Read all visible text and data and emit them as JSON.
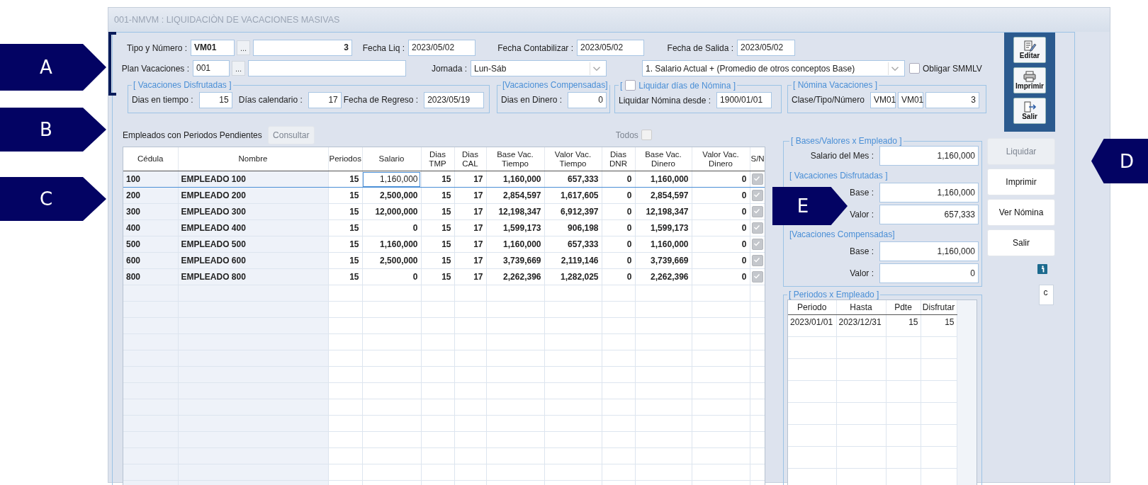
{
  "window": {
    "title": "001-NMVM : LIQUIDACIÒN DE VACACIONES MASIVAS"
  },
  "header": {
    "tipo_numero": {
      "label": "Tipo y Número :",
      "type": "VM01",
      "number": "3",
      "lookup": "..."
    },
    "fecha_liq": {
      "label": "Fecha Liq :",
      "value": "2023/05/02"
    },
    "fecha_contabilizar": {
      "label": "Fecha Contabilizar :",
      "value": "2023/05/02"
    },
    "fecha_salida": {
      "label": "Fecha de Salida :",
      "value": "2023/05/02"
    },
    "plan_vacaciones": {
      "label": "Plan Vacaciones :",
      "value": "001",
      "lookup": "..."
    },
    "jornada": {
      "label": "Jornada :",
      "value": "Lun-Sáb"
    },
    "base_calculo": {
      "value": "1. Salario Actual + (Promedio de otros conceptos Base)"
    },
    "obligar_smmlv": {
      "label": "Obligar SMMLV",
      "checked": false
    }
  },
  "vacaciones_disfrutadas": {
    "legend": "[ Vacaciones Disfrutadas ]",
    "dias_tiempo": {
      "label": "Dias en tiempo :",
      "value": "15"
    },
    "dias_calendario": {
      "label": "Días calendario :",
      "value": "17"
    },
    "fecha_regreso": {
      "label": "Fecha de Regreso :",
      "value": "2023/05/19"
    }
  },
  "vacaciones_compensadas": {
    "legend": "[Vacaciones Compensadas]",
    "dias_dinero": {
      "label": "Dias en Dinero :",
      "value": "0"
    }
  },
  "liquidar_nomina": {
    "bracket": "[",
    "legend": "Liquidar días de Nómina ]",
    "checked": false,
    "desde": {
      "label": "Liquidar Nómina desde :",
      "value": "1900/01/01"
    }
  },
  "nomina_vacaciones": {
    "legend": "[ Nómina Vacaciones ]",
    "label": "Clase/Tipo/Número",
    "clase": "VM01",
    "tipo": "VM01",
    "numero": "3"
  },
  "toolbar": [
    {
      "label": "Editar",
      "kind": "edit"
    },
    {
      "label": "Imprimir",
      "kind": "print"
    },
    {
      "label": "Salir",
      "kind": "exit"
    }
  ],
  "empleados": {
    "label": "Empleados con Periodos Pendientes",
    "consultar": {
      "label": "Consultar",
      "disabled": true
    },
    "todos": {
      "label": "Todos",
      "checked": false,
      "disabled": true
    }
  },
  "table": {
    "columns": [
      "Cédula",
      "Nombre",
      "Periodos",
      "Salario",
      "Dias TMP",
      "Dias CAL",
      "Base Vac. Tiempo",
      "Valor Vac. Tiempo",
      "Dias DNR",
      "Base Vac. Dinero",
      "Valor Vac. Dinero",
      "S/N"
    ],
    "rows": [
      {
        "cells": [
          "100",
          "EMPLEADO 100",
          "15",
          "1,160,000",
          "15",
          "17",
          "1,160,000",
          "657,333",
          "0",
          "1,160,000",
          "0"
        ],
        "sn": true,
        "selected": true
      },
      {
        "cells": [
          "200",
          "EMPLEADO 200",
          "15",
          "2,500,000",
          "15",
          "17",
          "2,854,597",
          "1,617,605",
          "0",
          "2,854,597",
          "0"
        ],
        "sn": true,
        "selected": false
      },
      {
        "cells": [
          "300",
          "EMPLEADO 300",
          "15",
          "12,000,000",
          "15",
          "17",
          "12,198,347",
          "6,912,397",
          "0",
          "12,198,347",
          "0"
        ],
        "sn": true,
        "selected": false
      },
      {
        "cells": [
          "400",
          "EMPLEADO 400",
          "15",
          "0",
          "15",
          "17",
          "1,599,173",
          "906,198",
          "0",
          "1,599,173",
          "0"
        ],
        "sn": true,
        "selected": false
      },
      {
        "cells": [
          "500",
          "EMPLEADO 500",
          "15",
          "1,160,000",
          "15",
          "17",
          "1,160,000",
          "657,333",
          "0",
          "1,160,000",
          "0"
        ],
        "sn": true,
        "selected": false
      },
      {
        "cells": [
          "600",
          "EMPLEADO 600",
          "15",
          "2,500,000",
          "15",
          "17",
          "3,739,669",
          "2,119,146",
          "0",
          "3,739,669",
          "0"
        ],
        "sn": true,
        "selected": false
      },
      {
        "cells": [
          "800",
          "EMPLEADO 800",
          "15",
          "0",
          "15",
          "17",
          "2,262,396",
          "1,282,025",
          "0",
          "2,262,396",
          "0"
        ],
        "sn": true,
        "selected": false
      }
    ]
  },
  "bases": {
    "legend": "[ Bases/Valores x Empleado ]",
    "salario_mes": {
      "label": "Salario del Mes :",
      "value": "1,160,000"
    },
    "disfrutadas": {
      "legend": "[ Vacaciones Disfrutadas ]",
      "base": {
        "label": "Base :",
        "value": "1,160,000"
      },
      "valor": {
        "label": "Valor :",
        "value": "657,333"
      }
    },
    "compensadas": {
      "legend": "[Vacaciones Compensadas]",
      "base": {
        "label": "Base :",
        "value": "1,160,000"
      },
      "valor": {
        "label": "Valor :",
        "value": "0"
      }
    }
  },
  "periodos": {
    "legend": "[ Periodos x Empleado ]",
    "columns": [
      "Periodo",
      "Hasta",
      "Pdte",
      "Disfrutar"
    ],
    "rows": [
      [
        "2023/01/01",
        "2023/12/31",
        "15",
        "15"
      ]
    ]
  },
  "buttons": [
    {
      "label": "Liquidar",
      "disabled": true
    },
    {
      "label": "Imprimir",
      "disabled": false
    },
    {
      "label": "Ver Nómina",
      "disabled": false
    },
    {
      "label": "Salir",
      "disabled": false
    }
  ],
  "side_box": "c",
  "callouts": [
    {
      "letter": "A",
      "kind": "right"
    },
    {
      "letter": "B",
      "kind": "right"
    },
    {
      "letter": "C",
      "kind": "right"
    },
    {
      "letter": "D",
      "kind": "left"
    },
    {
      "letter": "E",
      "kind": "right"
    }
  ]
}
